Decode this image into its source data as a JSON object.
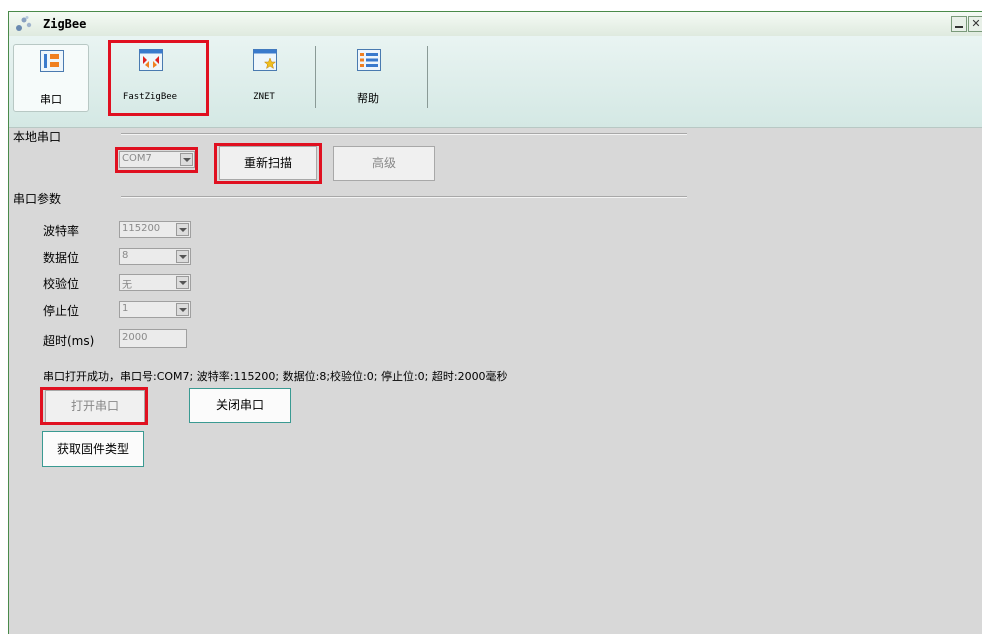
{
  "window": {
    "title": "ZigBee"
  },
  "toolbar": {
    "items": [
      {
        "label": "串口",
        "icon": "serial-port-icon"
      },
      {
        "label": "FastZigBee",
        "icon": "fast-zigbee-icon"
      },
      {
        "label": "ZNET",
        "icon": "znet-icon"
      },
      {
        "label": "帮助",
        "icon": "help-icon"
      }
    ]
  },
  "local_port": {
    "section_label": "本地串口",
    "port_value": "COM7",
    "rescan_label": "重新扫描",
    "advanced_label": "高级"
  },
  "params": {
    "section_label": "串口参数",
    "baud_label": "波特率",
    "baud_value": "115200",
    "databits_label": "数据位",
    "databits_value": "8",
    "parity_label": "校验位",
    "parity_value": "无",
    "stopbits_label": "停止位",
    "stopbits_value": "1",
    "timeout_label": "超时(ms)",
    "timeout_value": "2000"
  },
  "status_text": "串口打开成功，串口号:COM7; 波特率:115200; 数据位:8;校验位:0; 停止位:0; 超时:2000毫秒",
  "actions": {
    "open_label": "打开串口",
    "close_label": "关闭串口",
    "firmware_label": "获取固件类型"
  },
  "colors": {
    "highlight": "#e01020",
    "window_bg": "#d8d8d8",
    "toolbar_bg": "#d4e8e4",
    "accent_border": "#3a9a92"
  }
}
